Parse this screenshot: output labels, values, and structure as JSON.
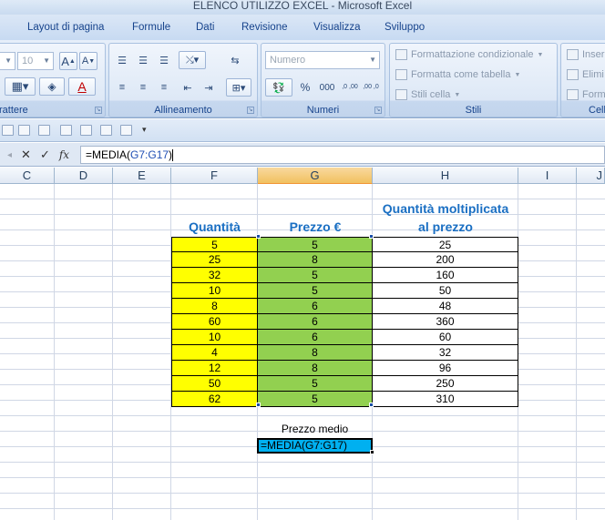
{
  "window": {
    "title": "ELENCO UTILIZZO EXCEL - Microsoft Excel"
  },
  "ribbon_tabs": [
    "Layout di pagina",
    "Formule",
    "Dati",
    "Revisione",
    "Visualizza",
    "Sviluppo"
  ],
  "ribbon": {
    "font": {
      "size_value": "10",
      "group_label": "rattere"
    },
    "alignment": {
      "group_label": "Allineamento"
    },
    "numbers": {
      "format_value": "Numero",
      "group_label": "Numeri",
      "percent": "%",
      "thousands": "000",
      "inc_dec": ",0 ,00",
      "dec_dec": ",00 ,0"
    },
    "styles": {
      "conditional": "Formattazione condizionale",
      "as_table": "Formatta come tabella",
      "cell_styles": "Stili cella",
      "group_label": "Stili"
    },
    "cells": {
      "insert": "Inser",
      "delete": "Elimi",
      "format": "Form",
      "group_label": "Cell"
    }
  },
  "formula_bar": {
    "fx": "fx",
    "prefix": "=MEDIA(",
    "range": "G7:G17",
    "suffix": ")"
  },
  "columns": [
    "C",
    "D",
    "E",
    "F",
    "G",
    "H",
    "I",
    "J"
  ],
  "table": {
    "header_quantita": "Quantità",
    "header_prezzo": "Prezzo €",
    "header_molt_line1": "Quantità moltiplicata",
    "header_molt_line2": "al prezzo",
    "rows": [
      {
        "q": "5",
        "p": "5",
        "t": "25"
      },
      {
        "q": "25",
        "p": "8",
        "t": "200"
      },
      {
        "q": "32",
        "p": "5",
        "t": "160"
      },
      {
        "q": "10",
        "p": "5",
        "t": "50"
      },
      {
        "q": "8",
        "p": "6",
        "t": "48"
      },
      {
        "q": "60",
        "p": "6",
        "t": "360"
      },
      {
        "q": "10",
        "p": "6",
        "t": "60"
      },
      {
        "q": "4",
        "p": "8",
        "t": "32"
      },
      {
        "q": "12",
        "p": "8",
        "t": "96"
      },
      {
        "q": "50",
        "p": "5",
        "t": "250"
      },
      {
        "q": "62",
        "p": "5",
        "t": "310"
      }
    ],
    "label_prezzo_medio": "Prezzo medio",
    "edit_value": "=MEDIA(G7:G17)"
  },
  "colors": {
    "yellow": "#ffff00",
    "green": "#92d050",
    "edit_blue": "#00b0f0",
    "header_blue": "#1a6fc3"
  }
}
